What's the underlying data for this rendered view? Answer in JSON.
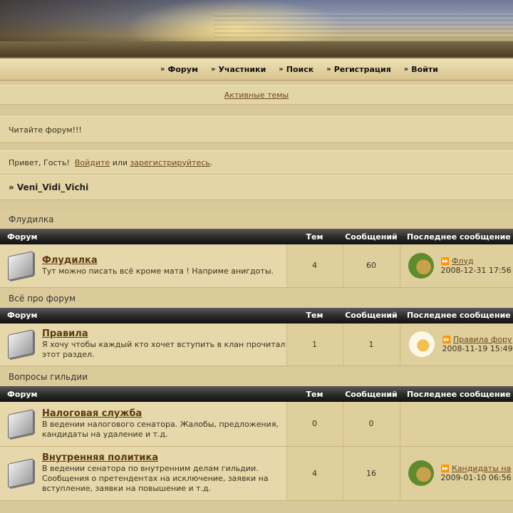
{
  "nav": [
    "Форум",
    "Участники",
    "Поиск",
    "Регистрация",
    "Войти"
  ],
  "active_topics": "Активные темы",
  "notice": "Читайте форум!!!",
  "greeting": {
    "prefix": "Привет, Гость!",
    "login": "Войдите",
    "or": "или",
    "register": "зарегистрируйтесь",
    "suffix": "."
  },
  "breadcrumb": "» Veni_Vidi_Vichi",
  "columns": {
    "forum": "Форум",
    "topics": "Тем",
    "posts": "Сообщений",
    "last": "Последнее сообщение"
  },
  "categories": [
    {
      "title": "Флудилка",
      "forums": [
        {
          "name": "Флудилка",
          "desc": "Тут можно писать всё кроме мата ! Наприме анигдоты.",
          "topics": "4",
          "posts": "60",
          "last_title": "Флуд",
          "last_date": "2008-12-31 17:56:",
          "avatar": "avatar-dog-icon"
        }
      ]
    },
    {
      "title": "Всё про форум",
      "forums": [
        {
          "name": "Правила",
          "desc": "Я хочу чтобы каждый кто хочет вступить в клан прочитал этот раздел.",
          "topics": "1",
          "posts": "1",
          "last_title": "Правила форум",
          "last_date": "2008-11-19 15:49:",
          "avatar": "avatar-cat-icon"
        }
      ]
    },
    {
      "title": "Вопросы гильдии",
      "forums": [
        {
          "name": "Налоговая служба",
          "desc": "В ведении налогового сенатора. Жалобы, предложения, кандидаты на удаление и т.д.",
          "topics": "0",
          "posts": "0",
          "last_title": "",
          "last_date": "",
          "avatar": ""
        },
        {
          "name": "Внутренняя политика",
          "desc": "В ведении сенатора по внутренним делам гильдии. Сообщения о претендентах на исключение, заявки на вступление, заявки на повышение и т.д.",
          "topics": "4",
          "posts": "16",
          "last_title": "Кандидаты на",
          "last_date": "2009-01-10 06:56:",
          "avatar": "avatar-dog-icon"
        }
      ]
    }
  ]
}
